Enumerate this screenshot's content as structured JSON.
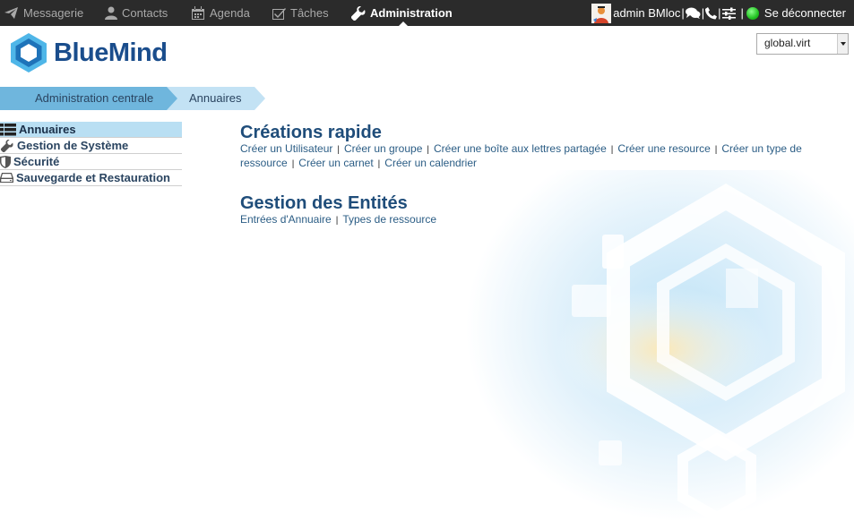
{
  "nav": {
    "items": [
      {
        "label": "Messagerie",
        "icon": "paper-plane-icon"
      },
      {
        "label": "Contacts",
        "icon": "user-icon"
      },
      {
        "label": "Agenda",
        "icon": "calendar-icon"
      },
      {
        "label": "Tâches",
        "icon": "checkbox-icon"
      },
      {
        "label": "Administration",
        "icon": "wrench-icon",
        "active": true
      }
    ],
    "user_label": "admin BMloc",
    "logout_label": "Se déconnecter"
  },
  "header": {
    "logo_text": "BlueMind",
    "domain_selected": "global.virt"
  },
  "breadcrumb": {
    "items": [
      "Administration centrale",
      "Annuaires"
    ]
  },
  "sidebar": {
    "items": [
      {
        "label": "Annuaires",
        "icon": "list-icon",
        "active": true
      },
      {
        "label": "Gestion de Système",
        "icon": "wrench-icon"
      },
      {
        "label": "Sécurité",
        "icon": "shield-icon"
      },
      {
        "label": "Sauvegarde et Restauration",
        "icon": "drive-icon"
      }
    ]
  },
  "main": {
    "quick_title": "Créations rapide",
    "quick_links": [
      "Créer un Utilisateur",
      "Créer un groupe",
      "Créer une boîte aux lettres partagée",
      "Créer une resource",
      "Créer un type de ressource",
      "Créer un carnet",
      "Créer un calendrier"
    ],
    "entities_title": "Gestion des Entités",
    "entity_links": [
      "Entrées d'Annuaire",
      "Types de ressource"
    ]
  },
  "colors": {
    "topbar": "#2b2b2b",
    "brand": "#1a4d8c",
    "breadcrumb_active": "#6fb6dd",
    "breadcrumb_current": "#c3e2f4",
    "sidebar_active": "#b9dff3",
    "link": "#2b5d85"
  }
}
